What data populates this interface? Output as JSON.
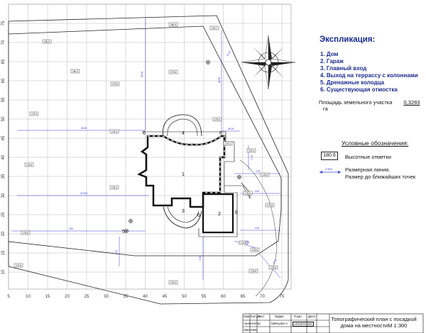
{
  "explication": {
    "title": "Экспликация:",
    "items": [
      "1. Дом",
      "2. Гараж",
      "3. Главный вход",
      "4. Выход на террассу с колоннами",
      "5. Дренажные колодца",
      "6. Существующая отмостка"
    ]
  },
  "area": {
    "label": "Площадь земельного участка",
    "value": "0,3283",
    "unit": "га"
  },
  "conventions": {
    "title": "Условные обозначения:",
    "elevation_sample": "180.6",
    "elevation_label": "Высотные отметки",
    "dimension_sample": "4.600",
    "dimension_label": "Размерная  линия.\nРазмер до ближайших точек"
  },
  "axes": {
    "x_ticks": [
      "5",
      "10",
      "15",
      "20",
      "25",
      "30",
      "35",
      "40",
      "45",
      "50",
      "55",
      "60",
      "65",
      "70",
      "75"
    ],
    "y_ticks": [
      "75",
      "70",
      "65",
      "60",
      "55",
      "50",
      "45",
      "40",
      "35",
      "30",
      "25",
      "20",
      "15",
      "10"
    ]
  },
  "plan_labels": {
    "house": "1",
    "garage": "2",
    "main_entrance": "3",
    "terrace_exit": "4",
    "drain_well": "5",
    "blind_area": "6"
  },
  "elevation_marks": [
    "180.6",
    "180.9",
    "178.7",
    "180.2",
    "179.8",
    "179.6",
    "179.9",
    "178.4",
    "179.6",
    "179.4",
    "178.6",
    "178.4",
    "179.4",
    "178.5",
    "178.8",
    "179.8",
    "178.8",
    "179.6",
    "178.8",
    "179.8",
    "178.3",
    "178.6",
    "178.8"
  ],
  "dimension_marks": [
    "36.50",
    "32.005",
    "36.56",
    "36.59",
    "33.02",
    "36.09",
    "3.74",
    "3.39",
    "4.69",
    "4.54",
    "3.50",
    "8.74",
    "4.06",
    "5.58",
    "3.60"
  ],
  "title_block": {
    "title": "Топографический план с посадкой дома на местностиМ 1:300",
    "headers": [
      "Изм.",
      "Кол.уч",
      "Лист",
      "№Док.",
      "Подп.",
      "Дата"
    ],
    "roles": [
      "Архитектор",
      "Заказчик"
    ],
    "names": [
      "Швецова А"
    ],
    "logo_text": "APOSTUDIA"
  },
  "colors": {
    "accent": "#1a2b8c",
    "grid": "#b8b8b8",
    "line": "#111111",
    "dimension": "#3b3bd6"
  }
}
